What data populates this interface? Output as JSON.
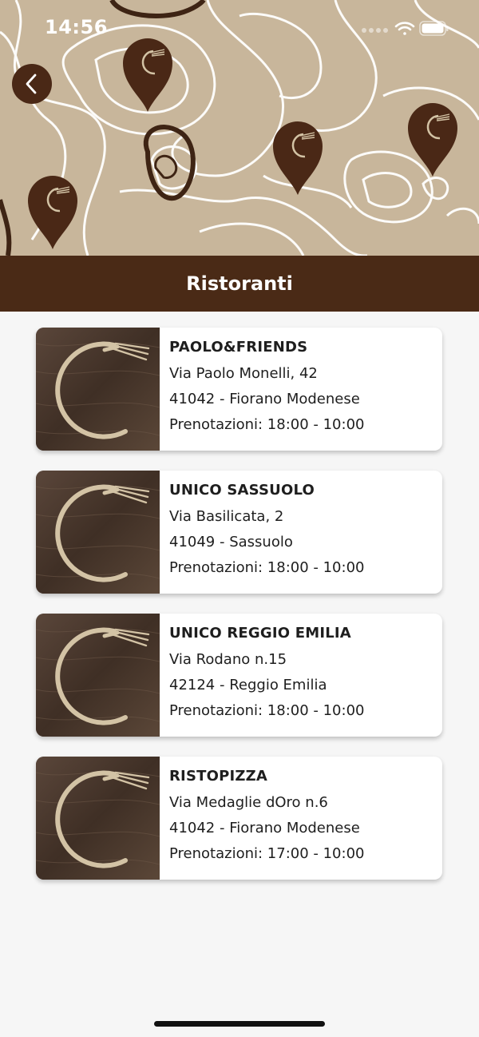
{
  "status_bar": {
    "time": "14:56"
  },
  "header": {
    "title": "Ristoranti"
  },
  "colors": {
    "brand_brown": "#4a2a16",
    "hero_beige": "#c8b69b",
    "logo_cream": "#d3c3a5"
  },
  "restaurants": [
    {
      "name": "PAOLO&FRIENDS",
      "address": "Via Paolo Monelli, 42",
      "city": "41042 - Fiorano Modenese",
      "hours": "Prenotazioni: 18:00 - 10:00"
    },
    {
      "name": "UNICO SASSUOLO",
      "address": "Via Basilicata, 2",
      "city": "41049 - Sassuolo",
      "hours": "Prenotazioni: 18:00 - 10:00"
    },
    {
      "name": "UNICO REGGIO EMILIA",
      "address": "Via Rodano n.15",
      "city": "42124 - Reggio Emilia",
      "hours": "Prenotazioni: 18:00 - 10:00"
    },
    {
      "name": "RISTOPIZZA",
      "address": "Via Medaglie dOro n.6",
      "city": "41042 - Fiorano Modenese",
      "hours": "Prenotazioni: 17:00 - 10:00"
    }
  ]
}
